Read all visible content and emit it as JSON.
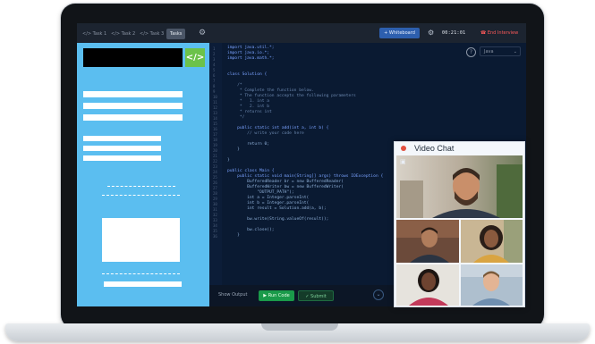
{
  "topbar": {
    "tabs": [
      "</> Task 1",
      "</> Task 2",
      "</> Task 3",
      "Tasks"
    ],
    "whiteboard_label": "+ Whiteboard",
    "timer": "00:21:01",
    "end_label": "End Interview"
  },
  "editor": {
    "language": "Java",
    "footer_label": "Show Output",
    "run_label": "Run Code",
    "submit_label": "Submit",
    "code_lines": [
      "import java.util.*;",
      "import java.io.*;",
      "import java.math.*;",
      "",
      "",
      "class Solution {",
      "",
      "    /*",
      "     * Complete the function below.",
      "     * The function accepts the following parameters",
      "     *   1. int a",
      "     *   2. int b",
      "     * returns int",
      "     */",
      "",
      "    public static int add(int a, int b) {",
      "        // write your code here",
      "",
      "        return 0;",
      "    }",
      "",
      "}",
      "",
      "public class Main {",
      "    public static void main(String[] args) throws IOException {",
      "        BufferedReader br = new BufferedReader(",
      "        BufferedWriter bw = new BufferedWriter(",
      "            \"OUTPUT_PATH\");",
      "        int a = Integer.parseInt(",
      "        int b = Integer.parseInt(",
      "        int result = Solution.add(a, b);",
      "",
      "        bw.write(String.valueOf(result));",
      "",
      "        bw.close();",
      "    }"
    ]
  },
  "video_chat": {
    "title": "Video Chat"
  },
  "colors": {
    "left_panel": "#5bbef0",
    "editor_bg": "#0a1a32",
    "run_green": "#1a9a4a",
    "code_icon_green": "#6cc24a",
    "end_red": "#ff5a5a"
  },
  "icons": [
    "settings-icon",
    "code-icon",
    "help-icon",
    "camera-icon",
    "record-dot"
  ]
}
